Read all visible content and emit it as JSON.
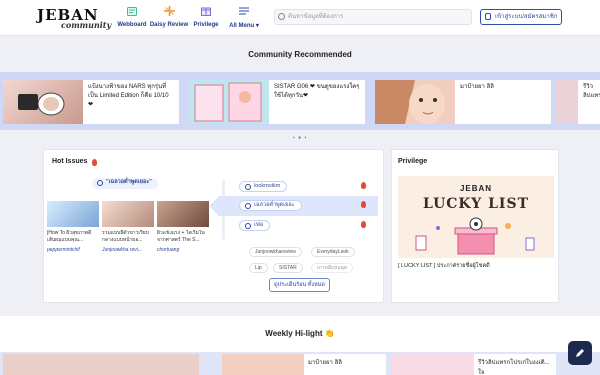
{
  "header": {
    "logo_text": "JEBAN",
    "logo_sub": "community",
    "nav": [
      {
        "label": "Webboard",
        "icon": "webboard-icon"
      },
      {
        "label": "Daisy Review",
        "icon": "daisy-icon"
      },
      {
        "label": "Privilege",
        "icon": "gift-icon"
      },
      {
        "label": "All Menu ▾",
        "icon": "menu-icon"
      }
    ],
    "search_placeholder": "ค้นหาข้อมูลที่ต้องการ",
    "login_label": "เข้าสู่ระบบ/สมัครสมาชิก"
  },
  "community": {
    "title": "Community Recommended",
    "cards": [
      {
        "title": "แป้งนางฟ้าของ NARS ทุกรุ่นที่เป็น Limited Edition ก็คือ 10/10 ❤"
      },
      {
        "title": "SISTAR G06 ❤ ขนตูของแรงใคๆ ใช้ได้ทุกวัน❤"
      },
      {
        "title": "มาป้ายยา ลิลิ"
      },
      {
        "title": "รีวิวลิปแทร"
      }
    ],
    "dots": "• ● •"
  },
  "hot": {
    "title": "Hot Issues",
    "selected_label": "\"เฉลวอต่ำพูดเยอะ\"",
    "posts": [
      {
        "caption": "[How To ผิวสุขภาพดี เส้นผมแบบคุณ...",
        "author": "peppermintchif"
      },
      {
        "caption": "รวมแบบยีตัวขาวเรียบกลางแบบหน้าผอ...",
        "author": "Junjoowkha revi..."
      },
      {
        "caption": "ผิวแข็งแรง + ใจเริ่มในจากศาสตร์ The S...",
        "author": "chortuang"
      }
    ],
    "keywords": [
      "lookmoikm",
      "เฉลวอต่ำพูดเยอะ",
      "เฟอ"
    ],
    "tags": [
      "Junjoowkhareview",
      "EverydayLook",
      "Lip",
      "SISTAR",
      "เกาหลีแบบฉุด"
    ],
    "more_label": "ดูประเด็นร้อน ทั้งหมด"
  },
  "privilege": {
    "title": "Privilege",
    "banner_brand": "JEBAN",
    "banner_title": "LUCKY LIST",
    "caption": "[ LUCKY LIST ] ประกาศรายชื่อผู้โชคดี"
  },
  "weekly": {
    "title": "Weekly Hi-light",
    "emoji": "👏",
    "cards": [
      {
        "title": "มาป้ายยา ลิลิ"
      },
      {
        "title": "รีวิวลิปแทรกโปรเก่ใบงงเดิ... ใจ"
      }
    ]
  },
  "colors": {
    "accent": "#2b4aa0",
    "band": "#cfd8f4",
    "fire": "#e34a3a"
  },
  "fab_icon": "pen-icon"
}
